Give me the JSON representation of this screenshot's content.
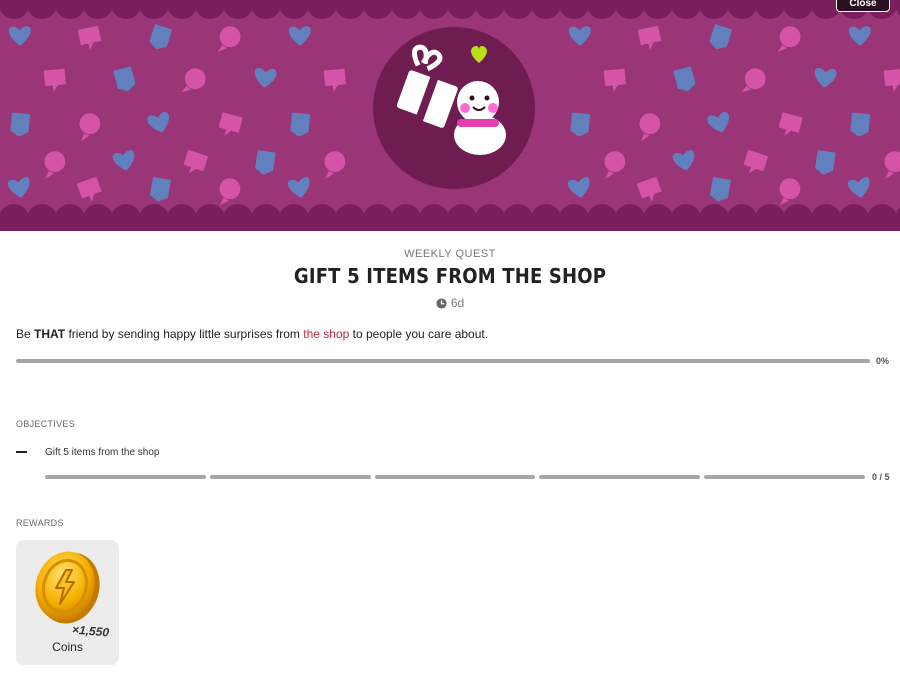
{
  "banner": {
    "close_label": "Close",
    "colors": {
      "background": "#9a3577",
      "scallop": "#7a1f5c",
      "hero_circle": "#6f1d50",
      "heart_accent": "#b8e016"
    },
    "hero_icon": "gift-and-snowman-icon"
  },
  "quest": {
    "type_label": "WEEKLY QUEST",
    "title": "GIFT 5 ITEMS FROM THE SHOP",
    "time_left": "6d",
    "time_icon": "clock-icon",
    "description_prefix": "Be ",
    "description_bold": "THAT",
    "description_middle": " friend by sending happy little surprises from ",
    "description_link": "the shop",
    "description_suffix": " to people you care about.",
    "progress": 0,
    "progress_label": "0%"
  },
  "objectives": {
    "section_label": "OBJECTIVES",
    "items": [
      {
        "label": "Gift 5 items from the shop",
        "current": 0,
        "total": 5,
        "count_label": "0 / 5"
      }
    ]
  },
  "rewards": {
    "section_label": "REWARDS",
    "items": [
      {
        "name": "Coins",
        "quantity": "×1,550",
        "icon": "coin-icon"
      }
    ]
  }
}
